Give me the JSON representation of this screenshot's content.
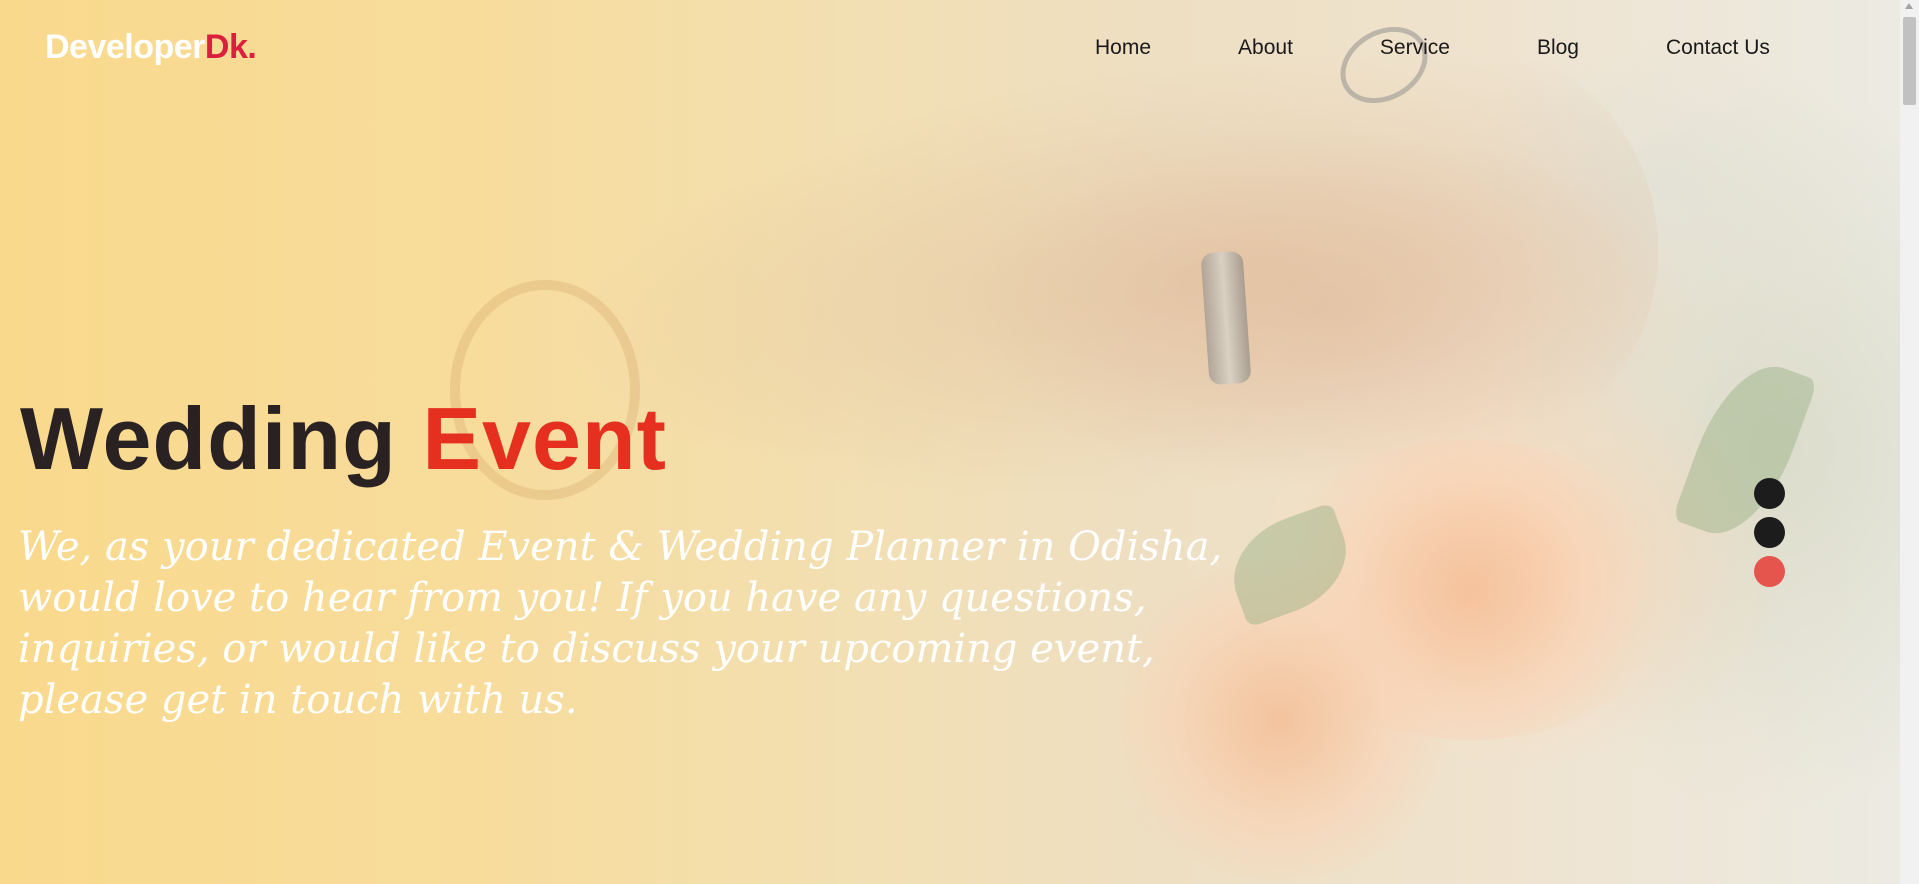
{
  "header": {
    "logo_main": "Developer",
    "logo_accent": "Dk.",
    "nav": [
      {
        "label": "Home"
      },
      {
        "label": "About"
      },
      {
        "label": "Service"
      },
      {
        "label": "Blog"
      },
      {
        "label": "Contact Us"
      }
    ]
  },
  "hero": {
    "title_main": "Wedding",
    "title_highlight": "Event",
    "text": "We, as your dedicated Event & Wedding Planner in Odisha, would love to hear from you! If you have any questions, inquiries, or would like to discuss your upcoming event, please get in touch with us."
  },
  "slider": {
    "active_index": 2,
    "dot_color": "#1c1c1c",
    "active_color": "#e5544d"
  },
  "colors": {
    "accent_red": "#e5301f",
    "logo_accent": "#dc1f3c",
    "title_dark": "#2a2222"
  }
}
